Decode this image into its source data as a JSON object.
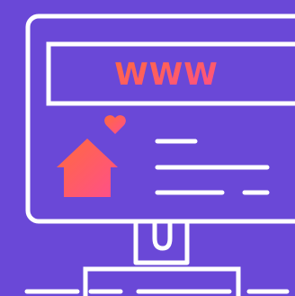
{
  "illustration": {
    "url_text": "WWW",
    "icon_names": [
      "monitor-icon",
      "house-icon",
      "heart-icon",
      "text-lines-icon"
    ],
    "colors": {
      "background": "#6a48d7",
      "stroke": "#ffffff",
      "accent_start": "#ff6a3d",
      "accent_end": "#ff4f8b"
    }
  }
}
